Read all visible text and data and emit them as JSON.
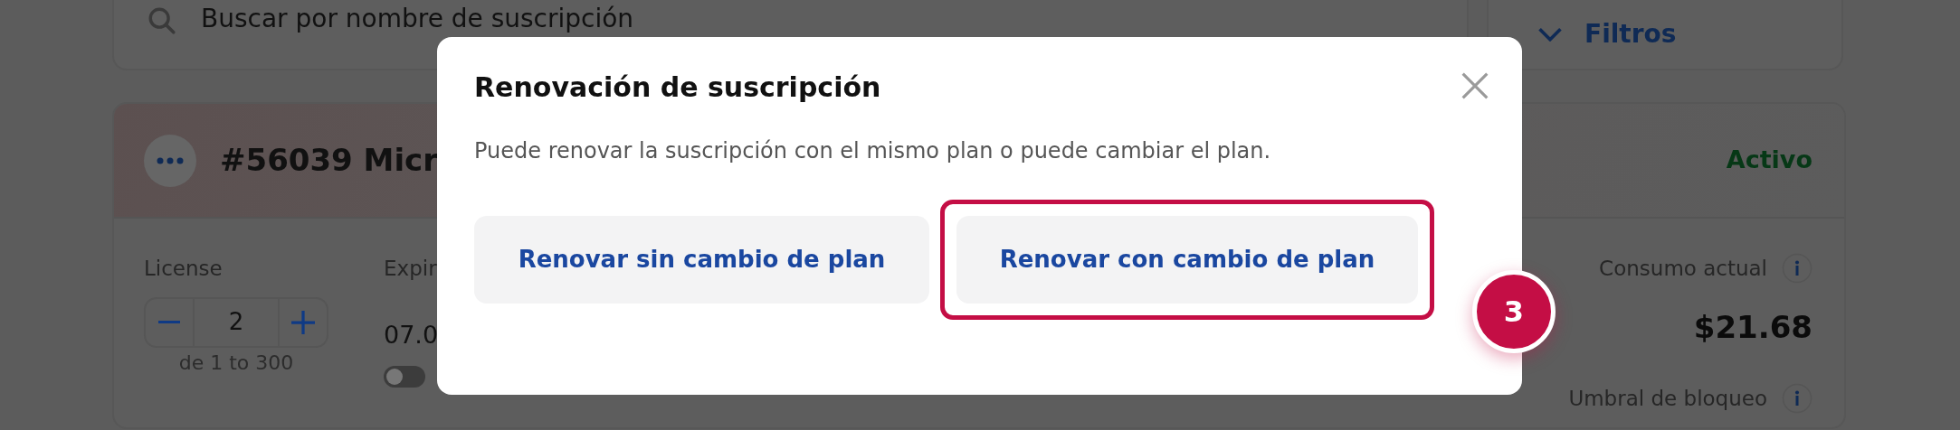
{
  "search": {
    "placeholder": "Buscar por nombre de suscripción"
  },
  "filters": {
    "label": "Filtros"
  },
  "subscription": {
    "title": "#56039 Micr",
    "status": "Activo",
    "license": {
      "label": "License",
      "value": "2",
      "range": "de 1 to 300"
    },
    "expiry": {
      "label": "Expir",
      "date": "07.0",
      "on": false
    },
    "usage": {
      "label": "Consumo actual",
      "amount": "$21.68"
    },
    "threshold": {
      "label": "Umbral de bloqueo"
    }
  },
  "dialog": {
    "title": "Renovación de suscripción",
    "message": "Puede renovar la suscripción con el mismo plan o puede cambiar el plan.",
    "buttons": [
      {
        "label": "Renovar sin cambio de plan",
        "highlighted": false
      },
      {
        "label": "Renovar con cambio de plan",
        "highlighted": true
      }
    ]
  },
  "step_badge": "3"
}
